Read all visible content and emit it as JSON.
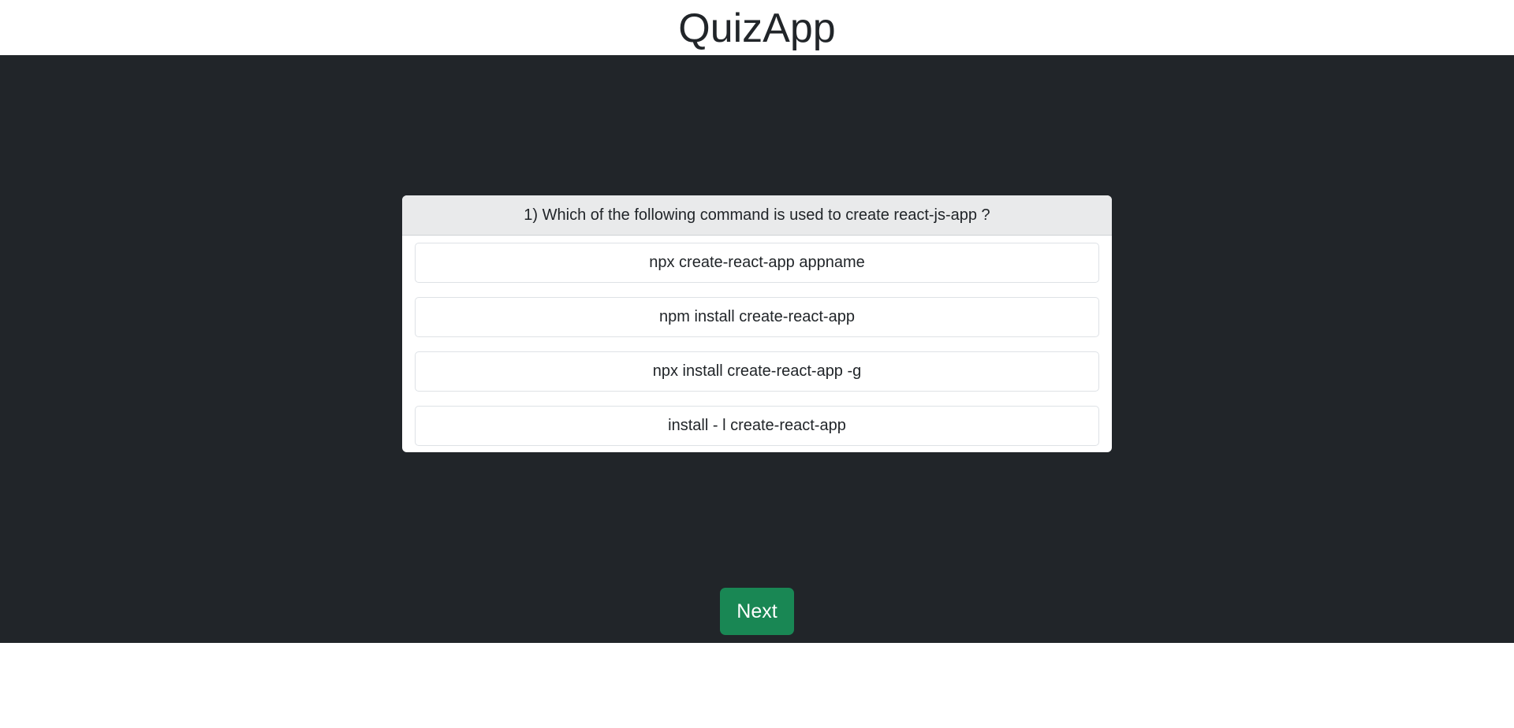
{
  "app": {
    "title": "QuizApp"
  },
  "question": {
    "text": "1) Which of the following command is used to create react-js-app ?",
    "options": [
      "npx create-react-app appname",
      "npm install create-react-app",
      "npx install create-react-app -g",
      "install - l create-react-app"
    ]
  },
  "controls": {
    "next_label": "Next"
  },
  "colors": {
    "stage_background": "#212529",
    "header_background": "#ffffff",
    "card_header_background": "#e9eaeb",
    "next_button": "#198754"
  }
}
